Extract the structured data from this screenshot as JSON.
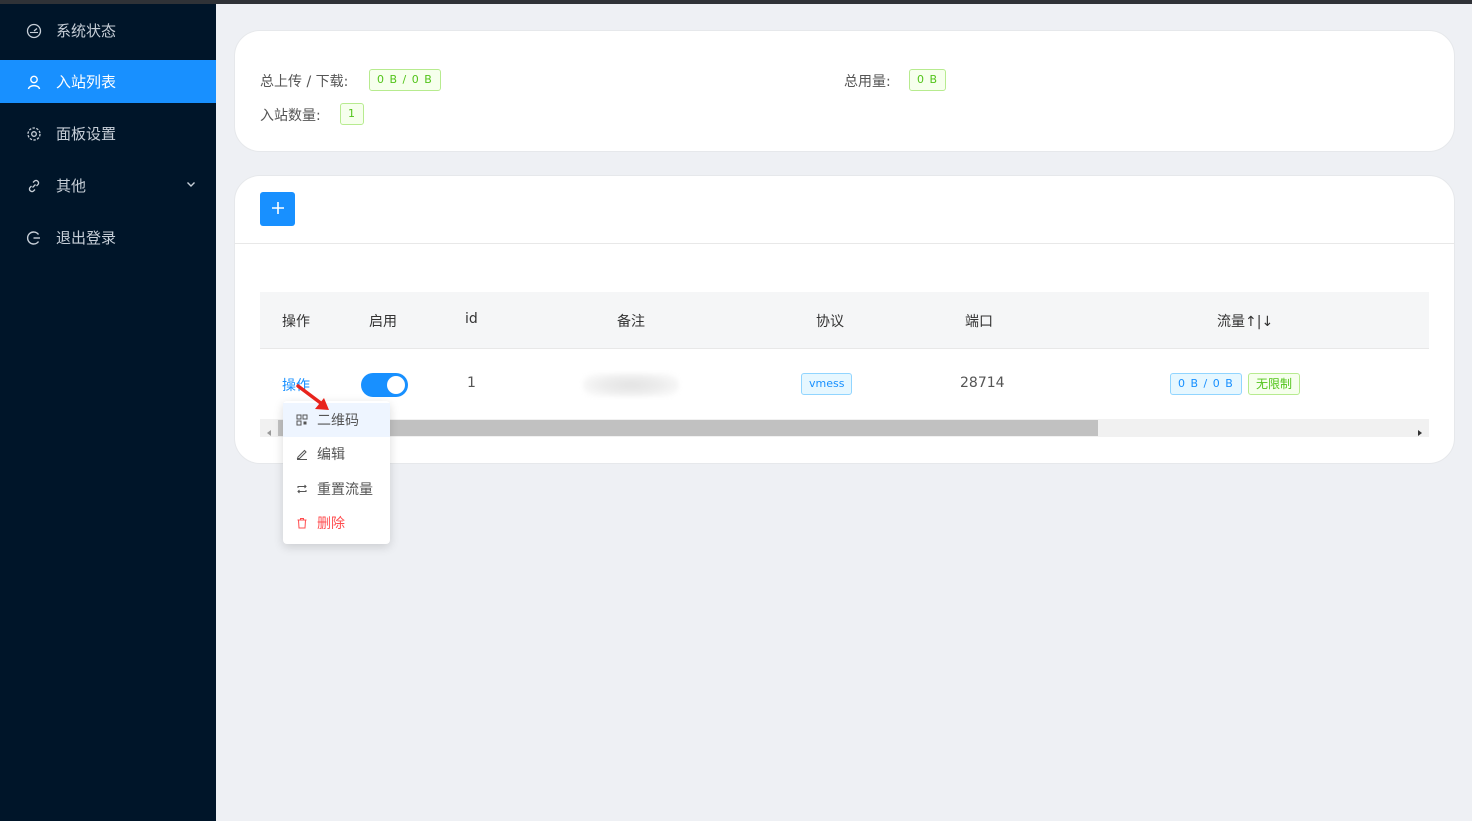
{
  "sidebar": {
    "items": [
      {
        "label": "系统状态",
        "icon": "dashboard-icon",
        "active": false
      },
      {
        "label": "入站列表",
        "icon": "user-icon",
        "active": true
      },
      {
        "label": "面板设置",
        "icon": "gear-icon",
        "active": false
      },
      {
        "label": "其他",
        "icon": "link-icon",
        "active": false,
        "expandable": true
      },
      {
        "label": "退出登录",
        "icon": "logout-icon",
        "active": false
      }
    ]
  },
  "stats": {
    "upload_download_label": "总上传 / 下载:",
    "upload_download_value": "0 B / 0 B",
    "total_usage_label": "总用量:",
    "total_usage_value": "0 B",
    "inbound_count_label": "入站数量:",
    "inbound_count_value": "1"
  },
  "toolbar": {
    "add_icon": "plus-icon"
  },
  "table": {
    "columns": [
      "操作",
      "启用",
      "id",
      "备注",
      "协议",
      "端口",
      "流量↑|↓"
    ],
    "rows": [
      {
        "action": "操作",
        "enabled": true,
        "id": "1",
        "remark": "",
        "protocol": "vmess",
        "port": "28714",
        "traffic": "0 B / 0 B",
        "limit": "无限制"
      }
    ]
  },
  "action_menu": {
    "items": [
      {
        "label": "二维码",
        "icon": "qrcode-icon"
      },
      {
        "label": "编辑",
        "icon": "edit-icon"
      },
      {
        "label": "重置流量",
        "icon": "reset-icon"
      },
      {
        "label": "删除",
        "icon": "delete-icon"
      }
    ]
  },
  "colors": {
    "sidebar_bg": "#001529",
    "primary": "#1890ff",
    "success": "#52c41a",
    "danger": "#ff4d4f"
  }
}
